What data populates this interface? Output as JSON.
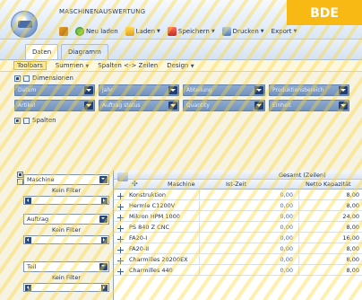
{
  "window": {
    "title": "MASCHINENAUSWERTUNG",
    "badge": "BDE"
  },
  "toolbar": {
    "reload": "Neu laden",
    "load": "Laden",
    "save": "Speichern",
    "print": "Drucken",
    "export": "Export"
  },
  "tabs": [
    {
      "label": "Daten"
    },
    {
      "label": "Diagramm"
    }
  ],
  "subtabs": [
    {
      "label": "Toolbars"
    },
    {
      "label": "Summen"
    },
    {
      "label": "Spalten <-> Zeilen"
    },
    {
      "label": "Design"
    }
  ],
  "sections": {
    "dimensions": "Dimensionen",
    "columns": "Spalten"
  },
  "dimension_fields_row1": [
    "Datum",
    "Jahr",
    "Abteilung",
    "Produktionsbereich"
  ],
  "dimension_fields_row2": [
    "Artikel",
    "Auftrag status",
    "Quantity",
    "Einheit"
  ],
  "filters": [
    {
      "field": "Maschine",
      "label": "Kein Filter"
    },
    {
      "field": "Auftrag",
      "label": "Kein Filter"
    },
    {
      "field": "Teil",
      "label": "Kein Filter"
    }
  ],
  "grid": {
    "group_header": "Gesamt (Zeilen)",
    "col_machine": "Maschine",
    "col_ist": "Ist-Zeit",
    "col_kap": "Netto Kapazität",
    "rows": [
      {
        "name": "Konstruktion",
        "ist": "0,00",
        "kap": "8,00"
      },
      {
        "name": "Hermle C1200V",
        "ist": "0,00",
        "kap": "8,00"
      },
      {
        "name": "Mikron HPM 1000",
        "ist": "0,00",
        "kap": "24,00"
      },
      {
        "name": "PS 840 Z CNC",
        "ist": "0,00",
        "kap": "8,00"
      },
      {
        "name": "FA20-I",
        "ist": "0,00",
        "kap": "16,00"
      },
      {
        "name": "FA20-II",
        "ist": "0,00",
        "kap": "8,00"
      },
      {
        "name": "Charmilles 20200EX",
        "ist": "0,00",
        "kap": "8,00"
      },
      {
        "name": "Charmilles 440",
        "ist": "0,00",
        "kap": "8,00"
      }
    ]
  },
  "colors": {
    "accent": "#f9b915",
    "ribbon": "#dbe7f6",
    "field": "#7f9cc6"
  }
}
